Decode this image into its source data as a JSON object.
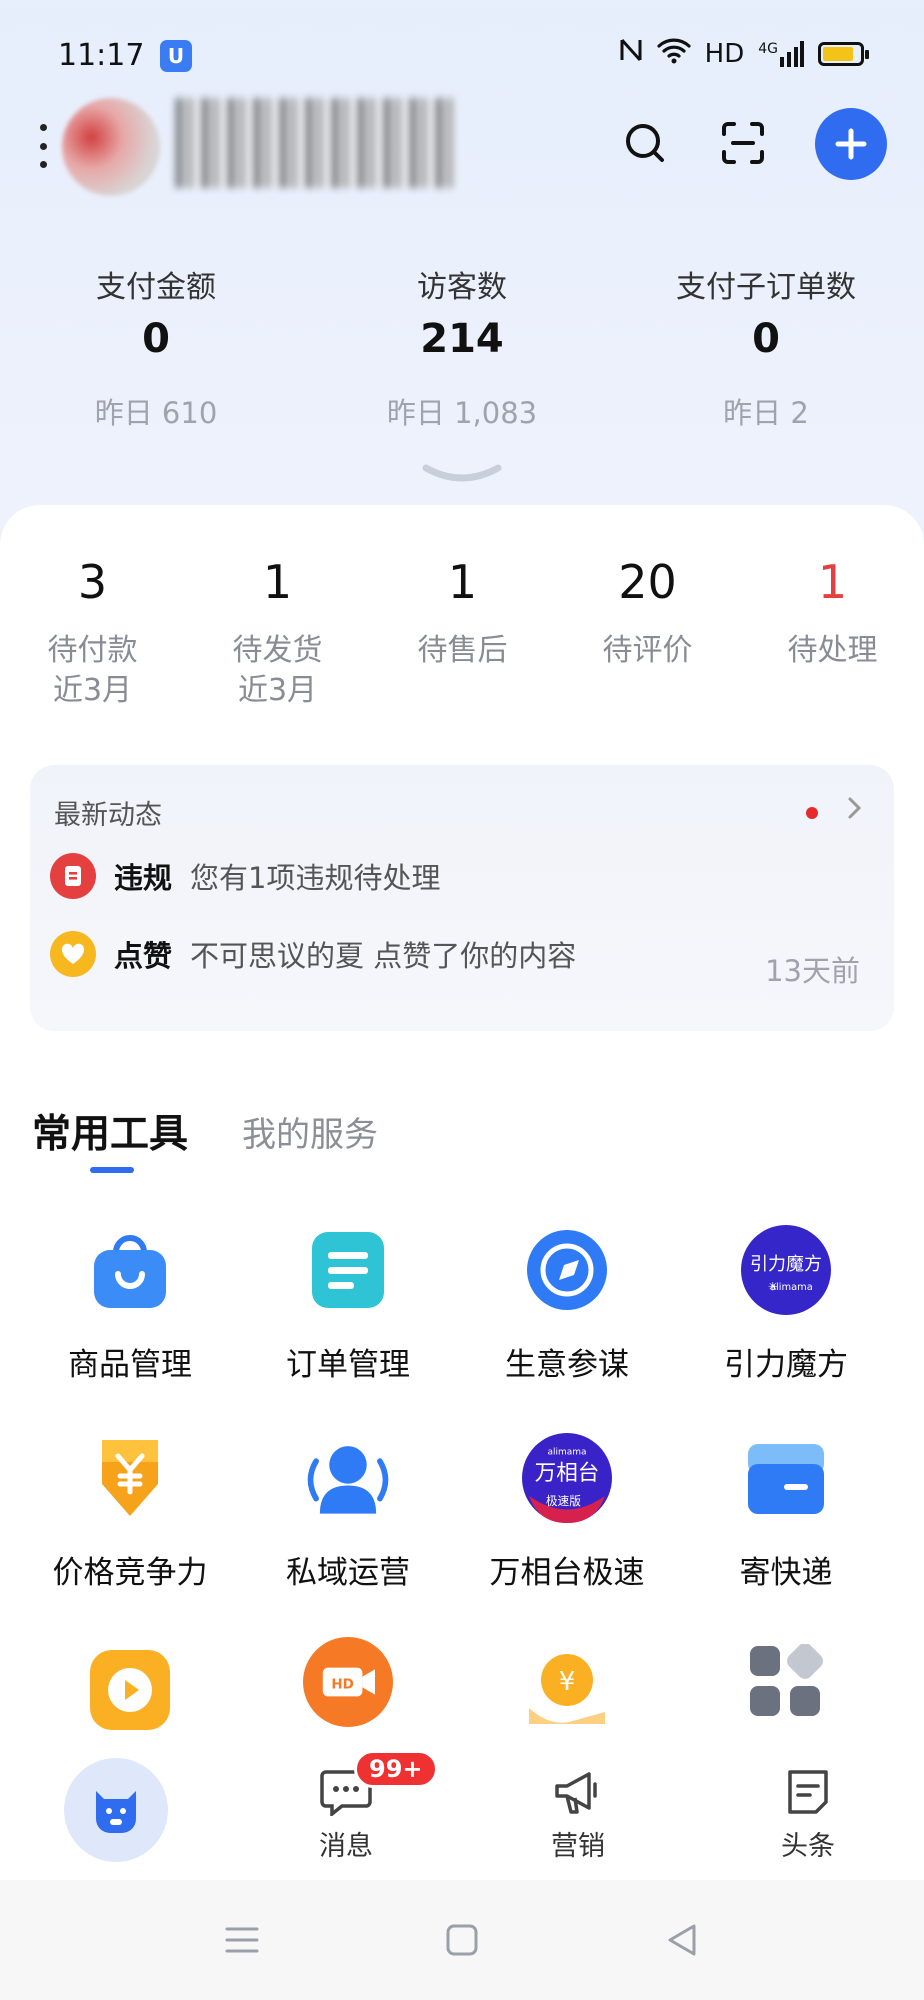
{
  "status_bar": {
    "time": "11:17",
    "network": "HD",
    "signal": "4G"
  },
  "header": {
    "shop_name": ""
  },
  "stats": [
    {
      "label": "支付金额",
      "value": "0",
      "yesterday": "昨日 610"
    },
    {
      "label": "访客数",
      "value": "214",
      "yesterday": "昨日 1,083"
    },
    {
      "label": "支付子订单数",
      "value": "0",
      "yesterday": "昨日 2"
    }
  ],
  "orders": [
    {
      "count": "3",
      "label": "待付款",
      "sub": "近3月"
    },
    {
      "count": "1",
      "label": "待发货",
      "sub": "近3月"
    },
    {
      "count": "1",
      "label": "待售后",
      "sub": ""
    },
    {
      "count": "20",
      "label": "待评价",
      "sub": ""
    },
    {
      "count": "1",
      "label": "待处理",
      "sub": ""
    }
  ],
  "news": {
    "title": "最新动态",
    "items": [
      {
        "tag": "违规",
        "text": "您有1项违规待处理",
        "time": ""
      },
      {
        "tag": "点赞",
        "text": "不可思议的夏 点赞了你的内容",
        "time": "13天前"
      }
    ]
  },
  "tabs": {
    "active": "常用工具",
    "inactive": "我的服务"
  },
  "tools": [
    {
      "label": "商品管理",
      "icon": "bag-icon"
    },
    {
      "label": "订单管理",
      "icon": "order-list-icon"
    },
    {
      "label": "生意参谋",
      "icon": "compass-icon"
    },
    {
      "label": "引力魔方",
      "icon": "gravity-cube-logo"
    },
    {
      "label": "价格竞争力",
      "icon": "yuan-shield-icon"
    },
    {
      "label": "私域运营",
      "icon": "user-group-icon"
    },
    {
      "label": "万相台极速",
      "icon": "wanxiangtai-logo"
    },
    {
      "label": "寄快递",
      "icon": "parcel-box-icon"
    }
  ],
  "brand_logos": {
    "yinli_text": "引力魔方",
    "yinli_sub": "alimama",
    "wxt_top": "alimama",
    "wxt_main": "万相台",
    "wxt_sub": "极速版"
  },
  "bottom_nav": {
    "messages_label": "消息",
    "messages_badge": "99+",
    "marketing_label": "营销",
    "headlines_label": "头条"
  },
  "colors": {
    "accent": "#2f6cf0",
    "alert_red": "#e54040",
    "like_yellow": "#f6b81e"
  }
}
